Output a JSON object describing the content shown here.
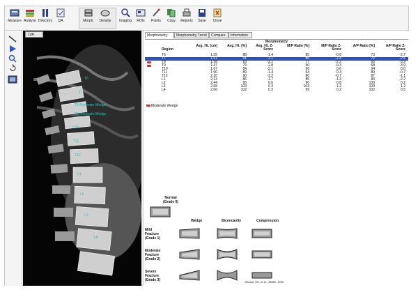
{
  "toolbar": {
    "items": [
      {
        "label": "Measure",
        "icon": "measure-icon"
      },
      {
        "label": "Analyze",
        "icon": "analyze-icon"
      },
      {
        "label": "Directory",
        "icon": "directory-icon"
      },
      {
        "label": "QA",
        "icon": "qa-icon"
      },
      {
        "label": "Morph.",
        "icon": "morphometry-icon"
      },
      {
        "label": "Density",
        "icon": "density-icon"
      },
      {
        "label": "Imaging",
        "icon": "imaging-icon"
      },
      {
        "label": "ROIs",
        "icon": "rois-icon"
      },
      {
        "label": "Points",
        "icon": "points-icon"
      },
      {
        "label": "Copy",
        "icon": "copy-icon"
      },
      {
        "label": "Reports",
        "icon": "reports-icon"
      },
      {
        "label": "Save",
        "icon": "save-icon"
      },
      {
        "label": "Close",
        "icon": "close-icon"
      }
    ]
  },
  "image": {
    "tab_label": "LVA",
    "vertebra_labels": [
      "T6",
      "T7",
      "T8 Moderate Wedge",
      "T9 Moderate Wedge",
      "T10",
      "T11",
      "T12",
      "L1",
      "L2",
      "L3",
      "L4"
    ]
  },
  "tabs": [
    "Morphometry",
    "Morphometry Trend",
    "Compare",
    "Information"
  ],
  "morphometry": {
    "title": "Morphometry",
    "columns": [
      "Region",
      "Avg. Ht. [cm]",
      "Avg. Ht. [%]",
      "Avg. Ht. Z-Score",
      "M/P Ratio [%]",
      "M/P Ratio Z-Score",
      "A/P Ratio [%]",
      "A/P Ratio Z-Score"
    ],
    "rows": [
      {
        "region": "T6",
        "c": [
          "1.55",
          "88",
          "-1.4",
          "85",
          "-0.8",
          "73",
          "-2.7"
        ]
      },
      {
        "region": "T7",
        "c": [
          "1.61",
          "91",
          "-1.1",
          "86",
          "-1.4",
          "72",
          "-2.5"
        ],
        "selected": true
      },
      {
        "region": "T8",
        "c": [
          "1.58",
          "83",
          "-2.1",
          "77",
          "-2.2",
          "65",
          "-3.9"
        ],
        "flag": true
      },
      {
        "region": "T9",
        "c": [
          "1.47",
          "79",
          "-2.8",
          "90",
          "-0.3",
          "68",
          "-3.9"
        ],
        "flag": true
      },
      {
        "region": "T10",
        "c": [
          "1.67",
          "84",
          "-2.1",
          "96",
          "0.6",
          "94",
          "0.0"
        ]
      },
      {
        "region": "T11",
        "c": [
          "1.90",
          "89",
          "-1.4",
          "94",
          "0.4",
          "89",
          "-0.7"
        ]
      },
      {
        "region": "T12",
        "c": [
          "2.10",
          "90",
          "-1.2",
          "86",
          "-0.7",
          "87",
          "-1.1"
        ]
      },
      {
        "region": "L1",
        "c": [
          "2.13",
          "86",
          "-1.7",
          "85",
          "-1.3",
          "80",
          "-2.2"
        ]
      },
      {
        "region": "L2",
        "c": [
          "2.44",
          "95",
          "0.6",
          "96",
          "0.8",
          "100",
          "0.2"
        ]
      },
      {
        "region": "L3",
        "c": [
          "2.68",
          "103",
          "0.3",
          "103",
          "1.2",
          "109",
          "1.2"
        ]
      },
      {
        "region": "L4",
        "c": [
          "2.66",
          "102",
          "0.3",
          "99",
          "0.2",
          "102",
          "0.5"
        ]
      }
    ],
    "legend": "Moderate Wedge"
  },
  "fracture_chart": {
    "normal_label": "Normal\n(Grade 0)",
    "column_labels": [
      "Wedge",
      "Biconcavity",
      "Compression"
    ],
    "row_labels": [
      "Mild\nFracture\n(Grade 1)",
      "Moderate\nFracture\n(Grade 2)",
      "Severe\nFracture\n(Grade 3)"
    ],
    "footnote": "Genant, HK, et al., JBMR, 1993"
  }
}
